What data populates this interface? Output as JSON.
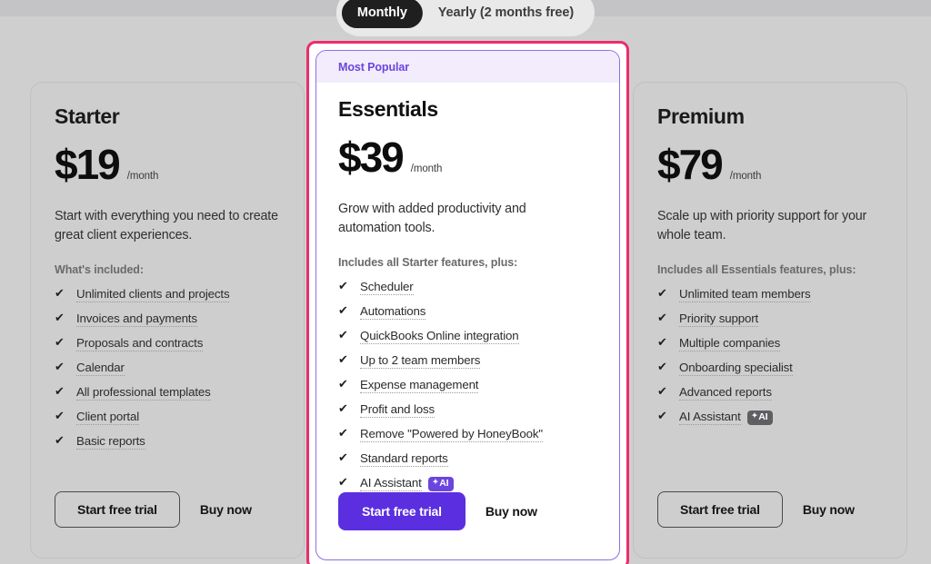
{
  "billing_toggle": {
    "name": "billing-period-toggle",
    "options": [
      {
        "label": "Monthly",
        "active": true
      },
      {
        "label": "Yearly (2 months free)",
        "active": false
      }
    ]
  },
  "plans": [
    {
      "id": "starter",
      "name": "Starter",
      "price": "$19",
      "period": "/month",
      "blurb": "Start with everything you need to create great client experiences.",
      "includes_label": "What's included:",
      "features": [
        {
          "label": "Unlimited clients and projects"
        },
        {
          "label": "Invoices and payments"
        },
        {
          "label": "Proposals and contracts"
        },
        {
          "label": "Calendar"
        },
        {
          "label": "All professional templates"
        },
        {
          "label": "Client portal"
        },
        {
          "label": "Basic reports"
        }
      ],
      "primary_cta": "Start free trial",
      "secondary_cta": "Buy now"
    },
    {
      "id": "essentials",
      "name": "Essentials",
      "badge": "Most Popular",
      "price": "$39",
      "period": "/month",
      "blurb": "Grow with added productivity and automation tools.",
      "includes_label": "Includes all Starter features, plus:",
      "features": [
        {
          "label": "Scheduler"
        },
        {
          "label": "Automations"
        },
        {
          "label": "QuickBooks Online integration"
        },
        {
          "label": "Up to 2 team members"
        },
        {
          "label": "Expense management"
        },
        {
          "label": "Profit and loss"
        },
        {
          "label": "Remove \"Powered by HoneyBook\""
        },
        {
          "label": "Standard reports"
        },
        {
          "label": "AI Assistant",
          "badge": "AI"
        }
      ],
      "primary_cta": "Start free trial",
      "secondary_cta": "Buy now"
    },
    {
      "id": "premium",
      "name": "Premium",
      "price": "$79",
      "period": "/month",
      "blurb": "Scale up with priority support for your whole team.",
      "includes_label": "Includes all Essentials features, plus:",
      "features": [
        {
          "label": "Unlimited team members"
        },
        {
          "label": "Priority support"
        },
        {
          "label": "Multiple companies"
        },
        {
          "label": "Onboarding specialist"
        },
        {
          "label": "Advanced reports"
        },
        {
          "label": "AI Assistant",
          "badge": "AI"
        }
      ],
      "primary_cta": "Start free trial",
      "secondary_cta": "Buy now"
    }
  ],
  "colors": {
    "selection_outline": "#ec2c6b",
    "brand_purple": "#5b2fe0",
    "badge_purple": "#6b45dd",
    "banner_lavender": "#f2ecfd",
    "page_background": "#cfcfcf",
    "card_background": "#cecece"
  }
}
